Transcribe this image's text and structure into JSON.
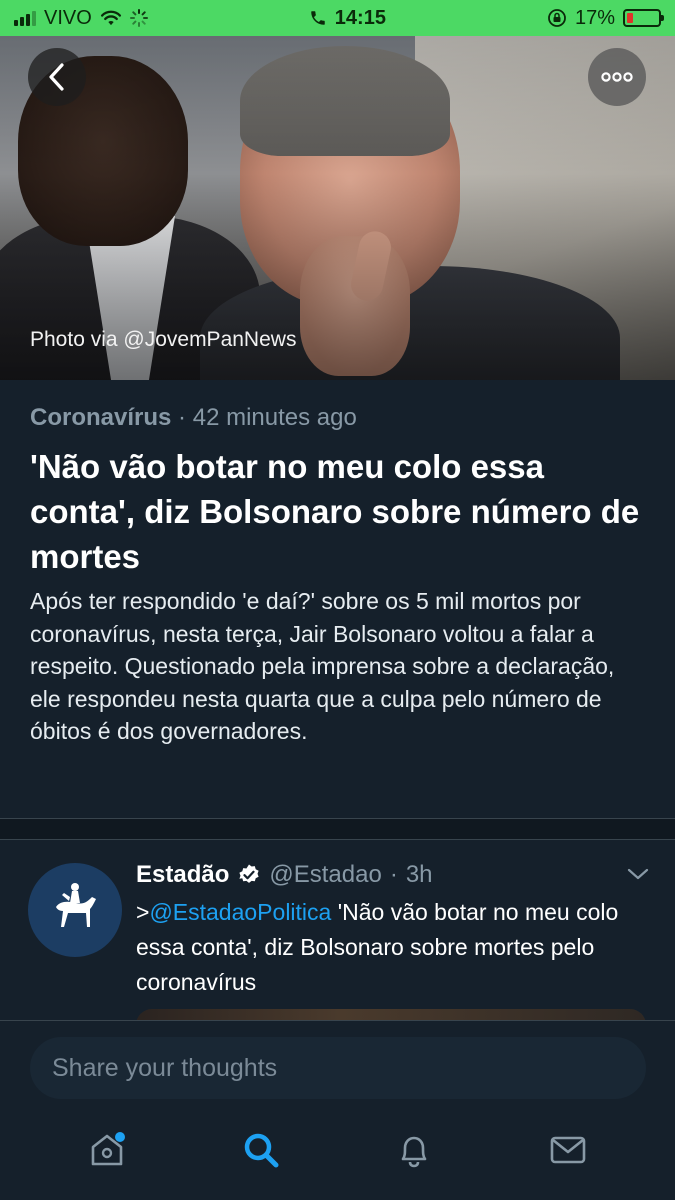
{
  "status_bar": {
    "carrier": "VIVO",
    "time": "14:15",
    "battery": "17%"
  },
  "hero": {
    "credit": "Photo via @JovemPanNews",
    "icons": {
      "back": "chevron-left-icon",
      "more": "more-horizontal-icon"
    }
  },
  "article": {
    "topic": "Coronavírus",
    "separator": "·",
    "time_ago": "42 minutes ago",
    "headline": "'Não vão botar no meu colo essa conta', diz Bolsonaro sobre número de mortes",
    "summary": "Após ter respondido 'e daí?' sobre os 5 mil mortos por coronavírus, nesta terça, Jair Bolsonaro voltou a falar a respeito. Questionado pela imprensa sobre a declaração, ele respondeu nesta quarta que a culpa pelo número de óbitos é dos governadores."
  },
  "tweet": {
    "name": "Estadão",
    "handle": "@Estadao",
    "dot": "·",
    "time": "3h",
    "text_prefix": ">",
    "mention": "@EstadaoPolitica",
    "text": " 'Não vão botar no meu colo essa conta', diz Bolsonaro sobre mortes pelo coronavírus"
  },
  "compose": {
    "placeholder": "Share your thoughts"
  },
  "tabbar": {
    "items": [
      "home-icon",
      "search-icon",
      "notifications-icon",
      "messages-icon"
    ],
    "active": "search-icon"
  },
  "colors": {
    "status_bar": "#4cd964",
    "background": "#15202b",
    "accent": "#1da1f2",
    "muted": "#8899a6"
  }
}
